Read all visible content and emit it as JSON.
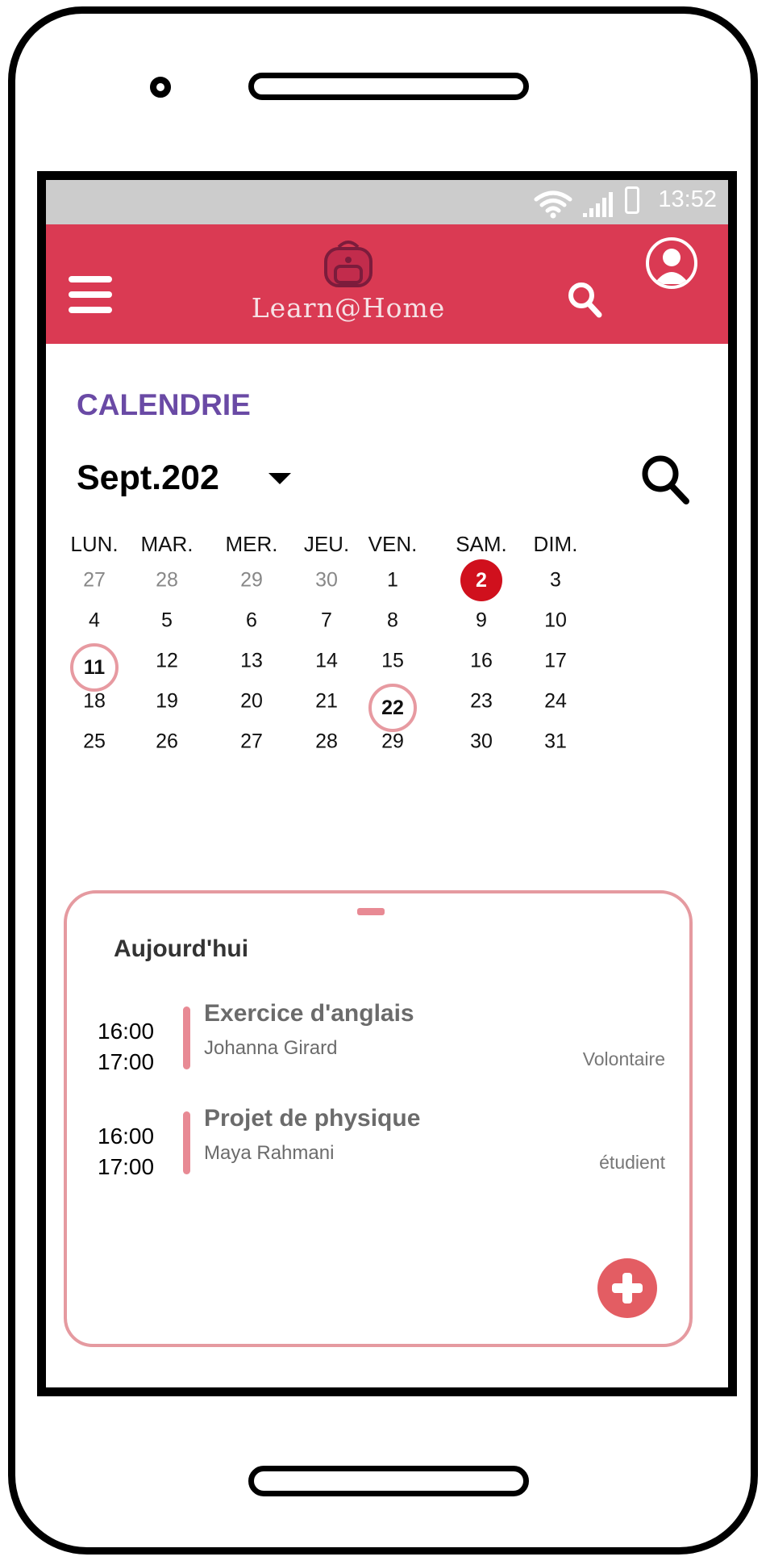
{
  "status_bar": {
    "time": "13:52",
    "icons": [
      "wifi-icon",
      "signal-icon",
      "battery-icon"
    ]
  },
  "app_bar": {
    "menu_icon": "hamburger-menu-icon",
    "logo_icon": "backpack-icon",
    "logo_text": "Learn@Home",
    "search_icon": "search-icon",
    "profile_icon": "user-avatar-icon",
    "bar_color": "#da3a53"
  },
  "page": {
    "title": "CALENDRIE",
    "title_color": "#6a4aa5"
  },
  "calendar": {
    "month_label": "Sept.202",
    "dropdown_icon": "caret-down-icon",
    "search_icon": "search-icon",
    "weekdays": [
      "LUN.",
      "MAR.",
      "MER.",
      "JEU.",
      "VEN.",
      "SAM.",
      "DIM."
    ],
    "weeks": [
      [
        "27",
        "28",
        "29",
        "30",
        "1",
        "2",
        "3"
      ],
      [
        "4",
        "5",
        "6",
        "7",
        "8",
        "9",
        "10"
      ],
      [
        "11",
        "12",
        "13",
        "14",
        "15",
        "16",
        "17"
      ],
      [
        "18",
        "19",
        "20",
        "21",
        "22",
        "23",
        "24"
      ],
      [
        "25",
        "26",
        "27",
        "28",
        "29",
        "30",
        "31"
      ]
    ],
    "muted_days": [
      "27",
      "28",
      "29",
      "30"
    ],
    "highlight_filled": "2",
    "highlight_rings": [
      "11",
      "22"
    ],
    "filled_color": "#d0101d",
    "ring_color": "#e79aa1"
  },
  "agenda": {
    "heading": "Aujourd'hui",
    "events": [
      {
        "start": "16:00",
        "end": "17:00",
        "title": "Exercice d'anglais",
        "person": "Johanna Girard",
        "role": "Volontaire"
      },
      {
        "start": "16:00",
        "end": "17:00",
        "title": "Projet de physique",
        "person": "Maya Rahmani",
        "role": "étudient"
      }
    ],
    "add_button_icon": "plus-icon",
    "accent_color": "#e88a94"
  }
}
